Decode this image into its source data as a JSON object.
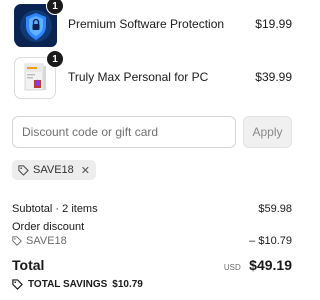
{
  "cart": {
    "items": [
      {
        "name": "Premium Software Protection",
        "price": "$19.99",
        "quantity": "1",
        "icon": "shield-lock-icon"
      },
      {
        "name": "Truly Max Personal for PC",
        "price": "$39.99",
        "quantity": "1",
        "icon": "software-box-icon"
      }
    ]
  },
  "discount": {
    "placeholder": "Discount code or gift card",
    "apply_label": "Apply",
    "applied_code": "SAVE18"
  },
  "summary": {
    "subtotal_label": "Subtotal · 2 items",
    "subtotal_value": "$59.98",
    "order_discount_label": "Order discount",
    "discount_code": "SAVE18",
    "discount_value": "– $10.79",
    "total_label": "Total",
    "currency": "USD",
    "total_value": "$49.19",
    "savings_label": "TOTAL SAVINGS",
    "savings_value": "$10.79"
  },
  "colors": {
    "accent": "#1a1a1a",
    "shield_blue": "#1e6fe0",
    "box_red": "#c0392b"
  }
}
